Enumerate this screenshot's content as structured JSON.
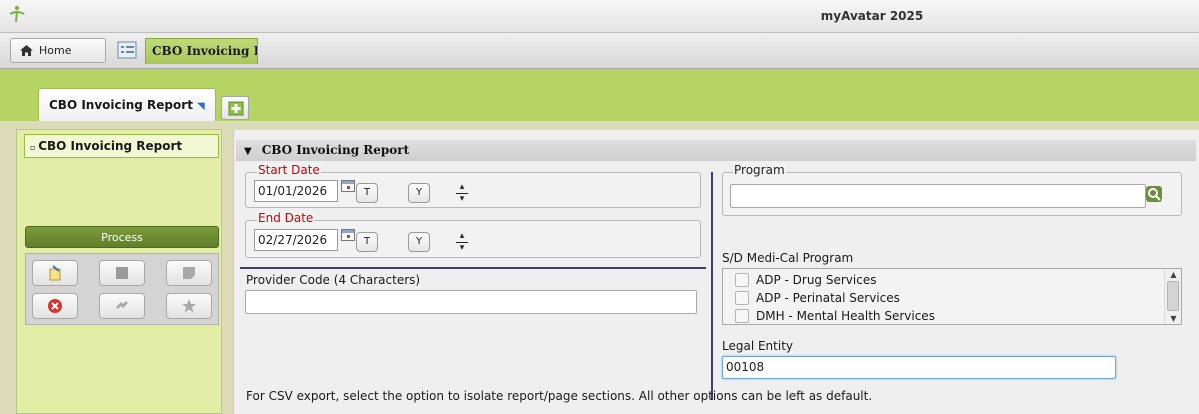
{
  "window": {
    "title": "myAvatar 2025"
  },
  "tabstrip": {
    "home_label": "Home",
    "app_tab_label": "CBO Invoicing R"
  },
  "form_tabs": {
    "active_label": "CBO Invoicing Report"
  },
  "sidebar": {
    "items": [
      {
        "label": "CBO Invoicing Report"
      }
    ],
    "process_label": "Process",
    "tools": [
      {
        "icon": "submit-icon",
        "enabled": true
      },
      {
        "icon": "save-icon",
        "enabled": false
      },
      {
        "icon": "note-icon",
        "enabled": false
      },
      {
        "icon": "cancel-icon",
        "enabled": true
      },
      {
        "icon": "puzzle-icon",
        "enabled": false
      },
      {
        "icon": "star-icon",
        "enabled": false
      }
    ]
  },
  "section": {
    "title": "CBO Invoicing Report"
  },
  "start_date": {
    "legend": "Start Date",
    "value": "01/01/2026",
    "today_btn": "T",
    "yesterday_btn": "Y"
  },
  "end_date": {
    "legend": "End Date",
    "value": "02/27/2026",
    "today_btn": "T",
    "yesterday_btn": "Y"
  },
  "provider_code": {
    "label": "Provider Code (4 Characters)",
    "value": ""
  },
  "program": {
    "legend": "Program",
    "value": ""
  },
  "medical_program": {
    "label": "S/D Medi-Cal Program",
    "options": [
      {
        "label": "ADP - Drug Services",
        "checked": false
      },
      {
        "label": "ADP - Perinatal Services",
        "checked": false
      },
      {
        "label": "DMH - Mental Health Services",
        "checked": false
      }
    ]
  },
  "legal_entity": {
    "label": "Legal Entity",
    "value": "00108"
  },
  "footer_note": "For CSV export, select the option to isolate report/page sections. All other options can be left as default.",
  "colors": {
    "accent_green": "#b6d463",
    "process_green": "#6d8b30",
    "required_red": "#cc0000",
    "divider_navy": "#3a3f7a"
  }
}
